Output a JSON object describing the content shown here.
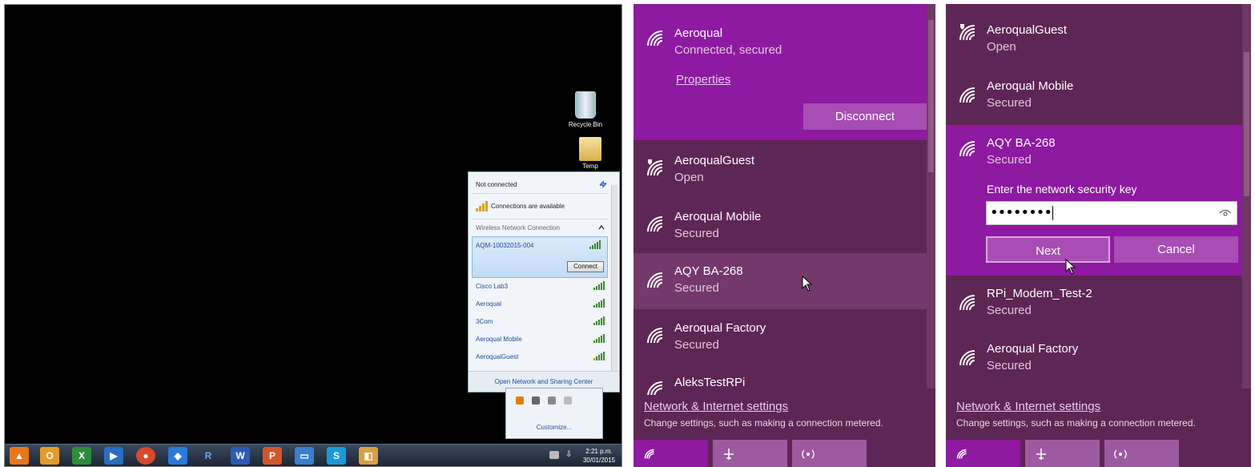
{
  "panel1": {
    "desktop_icons": [
      {
        "label": "Recycle Bin"
      },
      {
        "label": "Temp"
      }
    ],
    "network_popup": {
      "status": "Not connected",
      "availability": "Connections are available",
      "section": "Wireless Network Connection",
      "selected_network": "AQM-10032015-004",
      "connect_label": "Connect",
      "networks": [
        "Cisco Lab3",
        "Aeroqual",
        "3Com",
        "Aeroqual Mobile",
        "AeroqualGuest"
      ],
      "footer_link": "Open Network and Sharing Center"
    },
    "tray_popup": {
      "customize_label": "Customize..."
    },
    "taskbar": {
      "app_icons": [
        "vlc-icon",
        "outlook-icon",
        "excel-icon",
        "media-player-icon",
        "chrome-icon",
        "dropbox-icon",
        "r-icon",
        "word-icon",
        "powerpoint-icon",
        "explorer-icon",
        "skype-icon",
        "folder-sync-icon"
      ],
      "clock_time": "2:21 p.m.",
      "clock_date": "30/01/2015"
    }
  },
  "panel2": {
    "connected": {
      "ssid": "Aeroqual",
      "status": "Connected, secured",
      "properties_label": "Properties",
      "disconnect_label": "Disconnect"
    },
    "networks": [
      {
        "ssid": "AeroqualGuest",
        "status": "Open"
      },
      {
        "ssid": "Aeroqual Mobile",
        "status": "Secured"
      },
      {
        "ssid": "AQY BA-268",
        "status": "Secured"
      },
      {
        "ssid": "Aeroqual Factory",
        "status": "Secured"
      },
      {
        "ssid": "AleksTestRPi",
        "status": ""
      }
    ],
    "footer": {
      "link": "Network & Internet settings",
      "description": "Change settings, such as making a connection metered."
    }
  },
  "panel3": {
    "networks_top": [
      {
        "ssid": "AeroqualGuest",
        "status": "Open"
      },
      {
        "ssid": "Aeroqual Mobile",
        "status": "Secured"
      }
    ],
    "selected": {
      "ssid": "AQY BA-268",
      "status": "Secured",
      "key_prompt": "Enter the network security key",
      "password_mask": "••••••••",
      "next_label": "Next",
      "cancel_label": "Cancel"
    },
    "networks_bottom": [
      {
        "ssid": "RPi_Modem_Test-2",
        "status": "Secured"
      },
      {
        "ssid": "Aeroqual Factory",
        "status": "Secured"
      }
    ],
    "footer": {
      "link": "Network & Internet settings",
      "description": "Change settings, such as making a connection metered."
    }
  },
  "colors": {
    "win10_panel_bg": "#5e2654",
    "win10_accent": "#8d1aa0",
    "win10_hover": "#74386a",
    "win7_link": "#1e4e9a"
  }
}
